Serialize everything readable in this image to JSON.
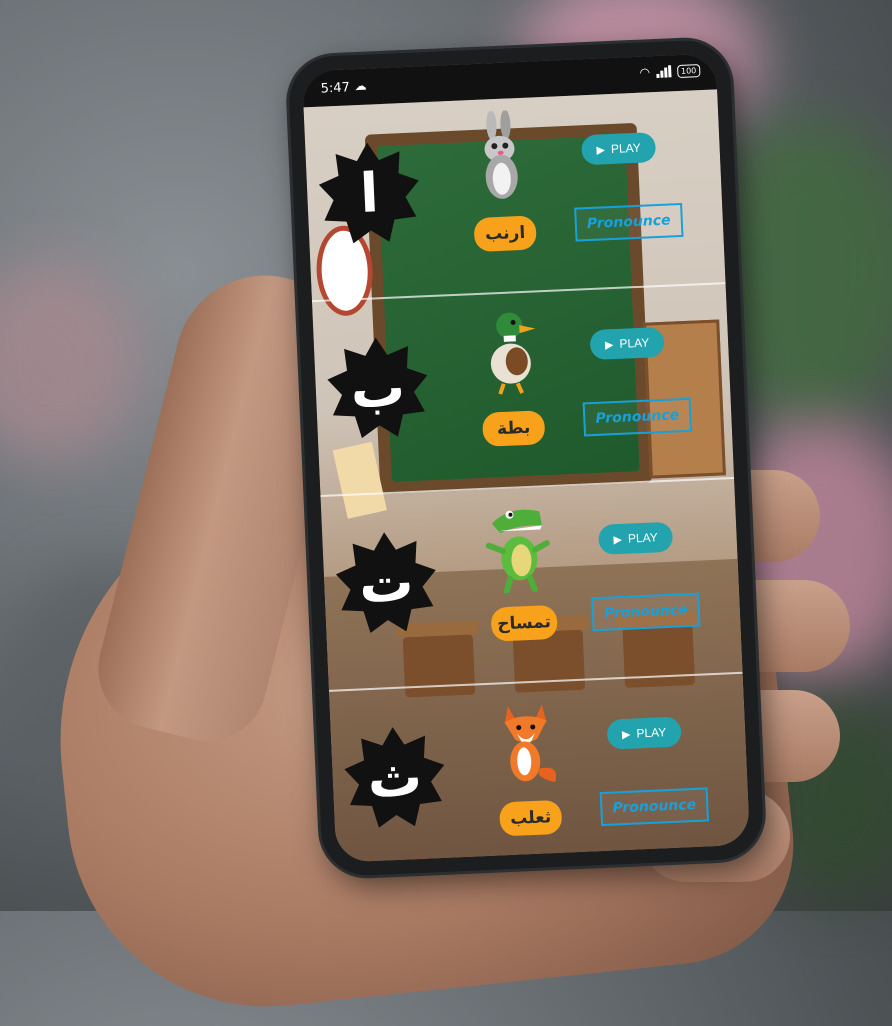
{
  "status_bar": {
    "time": "5:47",
    "battery": "100"
  },
  "app": {
    "rows": [
      {
        "letter": "ا",
        "word": "ارنب",
        "animal": "rabbit-icon",
        "play_label": "PLAY",
        "pronounce_label": "Pronounce"
      },
      {
        "letter": "ب",
        "word": "بطة",
        "animal": "duck-icon",
        "play_label": "PLAY",
        "pronounce_label": "Pronounce"
      },
      {
        "letter": "ت",
        "word": "تمساح",
        "animal": "crocodile-icon",
        "play_label": "PLAY",
        "pronounce_label": "Pronounce"
      },
      {
        "letter": "ث",
        "word": "ثعلب",
        "animal": "fox-icon",
        "play_label": "PLAY",
        "pronounce_label": "Pronounce"
      }
    ]
  },
  "colors": {
    "play": "#23a3ad",
    "pronounce": "#18a0d8",
    "badge": "#f7a21a",
    "star": "#111111"
  }
}
